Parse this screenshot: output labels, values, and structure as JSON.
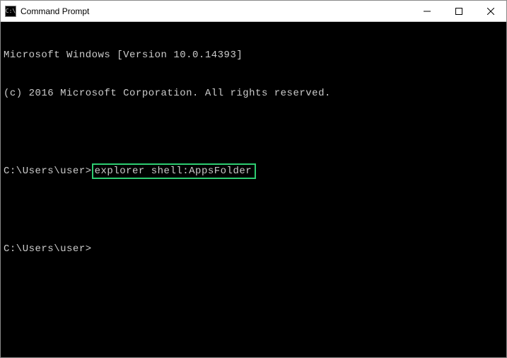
{
  "window": {
    "title": "Command Prompt",
    "icon_text": "C:\\"
  },
  "terminal": {
    "line1": "Microsoft Windows [Version 10.0.14393]",
    "line2": "(c) 2016 Microsoft Corporation. All rights reserved.",
    "prompt1": "C:\\Users\\user>",
    "command1": "explorer shell:AppsFolder",
    "prompt2": "C:\\Users\\user>"
  }
}
